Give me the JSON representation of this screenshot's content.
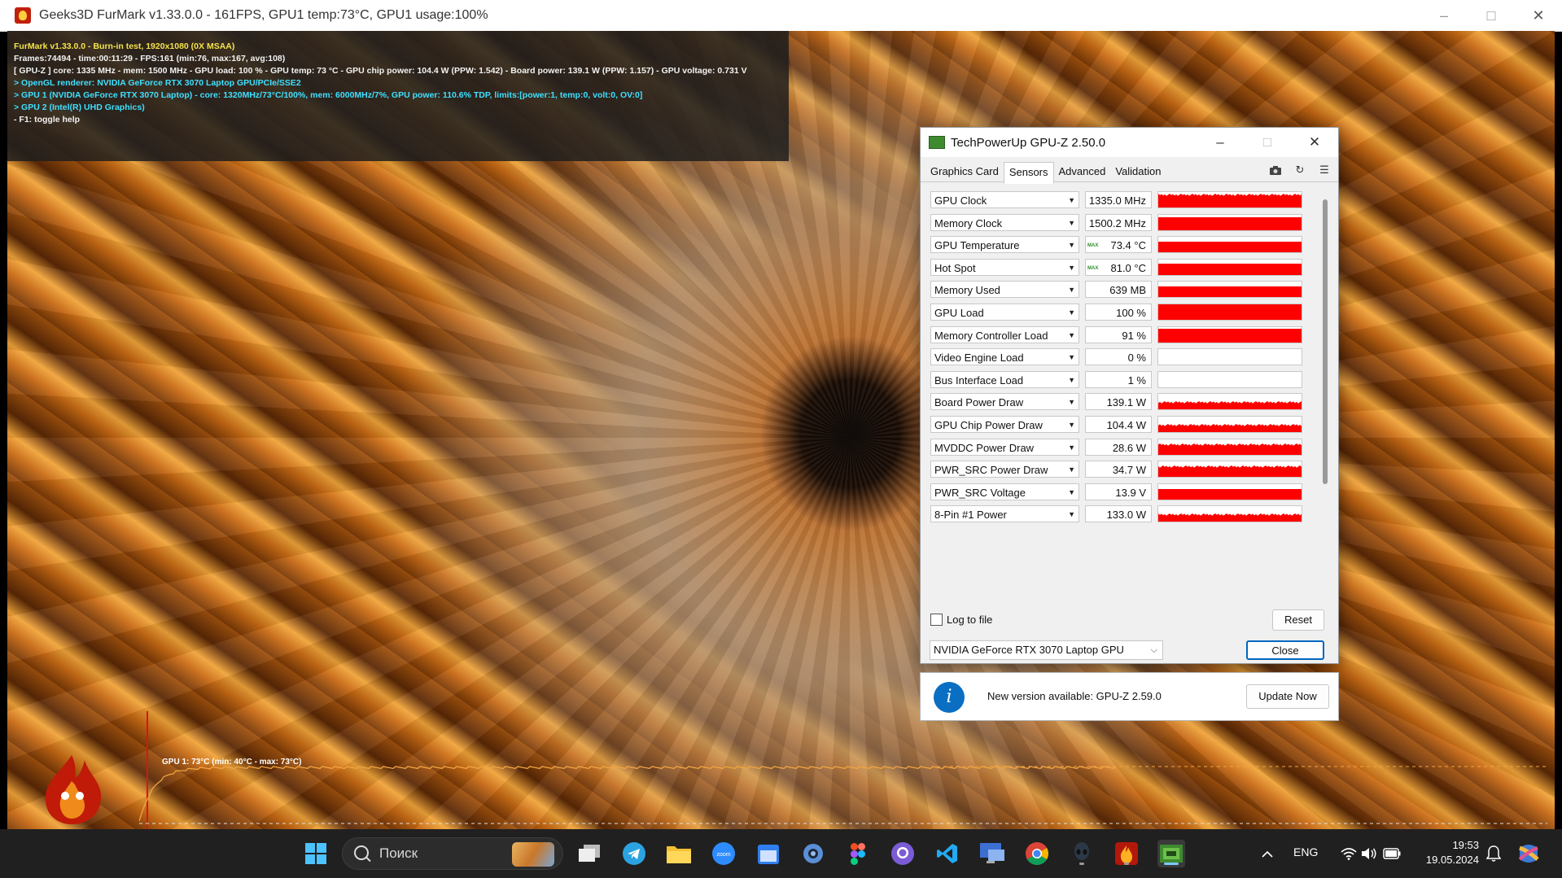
{
  "furmark": {
    "window_title": "Geeks3D FurMark v1.33.0.0 - 161FPS, GPU1 temp:73°C, GPU1 usage:100%",
    "hud": [
      {
        "text": "FurMark v1.33.0.0 - Burn-in test, 1920x1080 (0X MSAA)",
        "color": "yellow"
      },
      {
        "text": "Frames:74494 - time:00:11:29 - FPS:161 (min:76, max:167, avg:108)",
        "color": "white"
      },
      {
        "text": "[ GPU-Z ] core: 1335 MHz - mem: 1500 MHz - GPU load: 100 % - GPU temp: 73 °C - GPU chip power: 104.4 W (PPW: 1.542) - Board power: 139.1 W (PPW: 1.157) - GPU voltage: 0.731 V",
        "color": "white"
      },
      {
        "text": "> OpenGL renderer: NVIDIA GeForce RTX 3070 Laptop GPU/PCIe/SSE2",
        "color": "cyan"
      },
      {
        "text": "> GPU 1 (NVIDIA GeForce RTX 3070 Laptop) - core: 1320MHz/73°C/100%, mem: 6000MHz/7%, GPU power: 110.6% TDP, limits:[power:1, temp:0, volt:0, OV:0]",
        "color": "cyan"
      },
      {
        "text": "> GPU 2 (Intel(R) UHD Graphics)",
        "color": "cyan"
      },
      {
        "text": "- F1: toggle help",
        "color": "white"
      }
    ],
    "graph_label": "GPU 1: 73°C (min: 40°C - max: 73°C)",
    "graph_color": "#f2a541"
  },
  "gpuz": {
    "title": "TechPowerUp GPU-Z 2.50.0",
    "tabs": [
      "Graphics Card",
      "Sensors",
      "Advanced",
      "Validation"
    ],
    "active_tab": "Sensors",
    "sensors": [
      {
        "name": "GPU Clock",
        "value": "1335.0 MHz",
        "level": 0.92,
        "max": false,
        "noisy": true
      },
      {
        "name": "Memory Clock",
        "value": "1500.2 MHz",
        "level": 0.85,
        "max": false,
        "noisy": false
      },
      {
        "name": "GPU Temperature",
        "value": "73.4 °C",
        "level": 0.7,
        "max": true,
        "noisy": false
      },
      {
        "name": "Hot Spot",
        "value": "81.0 °C",
        "level": 0.75,
        "max": true,
        "noisy": false
      },
      {
        "name": "Memory Used",
        "value": "639 MB",
        "level": 0.7,
        "max": false,
        "noisy": false
      },
      {
        "name": "GPU Load",
        "value": "100 %",
        "level": 1.0,
        "max": false,
        "noisy": false
      },
      {
        "name": "Memory Controller Load",
        "value": "91 %",
        "level": 0.88,
        "max": false,
        "noisy": false
      },
      {
        "name": "Video Engine Load",
        "value": "0 %",
        "level": 0.0,
        "max": false,
        "noisy": false
      },
      {
        "name": "Bus Interface Load",
        "value": "1 %",
        "level": 0.0,
        "max": false,
        "noisy": false
      },
      {
        "name": "Board Power Draw",
        "value": "139.1 W",
        "level": 0.55,
        "max": false,
        "noisy": true
      },
      {
        "name": "GPU Chip Power Draw",
        "value": "104.4 W",
        "level": 0.55,
        "max": false,
        "noisy": true
      },
      {
        "name": "MVDDC Power Draw",
        "value": "28.6 W",
        "level": 0.72,
        "max": false,
        "noisy": true
      },
      {
        "name": "PWR_SRC Power Draw",
        "value": "34.7 W",
        "level": 0.72,
        "max": false,
        "noisy": true
      },
      {
        "name": "PWR_SRC Voltage",
        "value": "13.9 V",
        "level": 0.7,
        "max": false,
        "noisy": false
      },
      {
        "name": "8-Pin #1 Power",
        "value": "133.0 W",
        "level": 0.55,
        "max": false,
        "noisy": true
      }
    ],
    "log_to_file": "Log to file",
    "reset": "Reset",
    "gpu_select": "NVIDIA GeForce RTX 3070 Laptop GPU",
    "close": "Close",
    "update_text": "New version available: GPU-Z 2.59.0",
    "update_button": "Update Now",
    "info_glyph": "i"
  },
  "taskbar": {
    "search_placeholder": "Поиск",
    "language": "ENG",
    "time": "19:53",
    "date": "19.05.2024"
  },
  "colors": {
    "sensor_bar": "#ff0000",
    "accent": "#0067c0",
    "taskbar": "#202020"
  }
}
